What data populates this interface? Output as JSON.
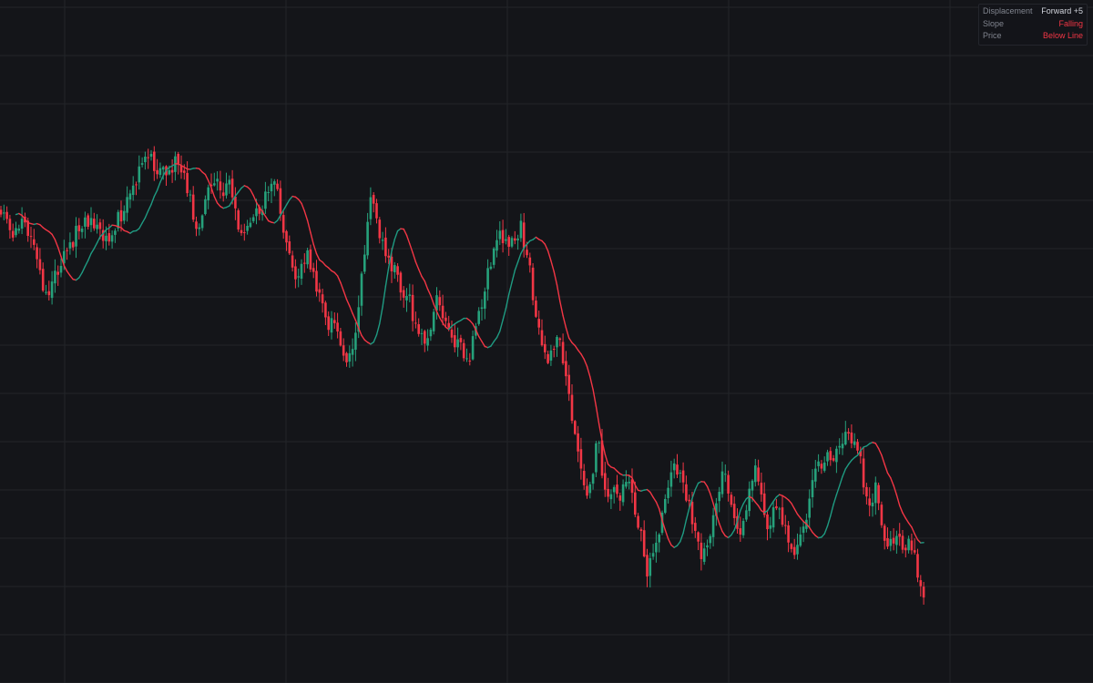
{
  "legend": {
    "displacement_label": "Displacement",
    "displacement_value": "Forward +5",
    "slope_label": "Slope",
    "slope_value": "Falling",
    "price_label": "Price",
    "price_value": "Below Line"
  },
  "colors": {
    "background": "#141519",
    "grid": "#232529",
    "up": "#26a17b",
    "down": "#f23645",
    "line_rising": "#1f9b82",
    "line_falling": "#f23645"
  },
  "chart_data": {
    "type": "candlestick",
    "grid": true,
    "legend_position": "top-right",
    "indicator": {
      "type": "displaced moving average",
      "displacement": 5
    },
    "series_waypoints": [
      [
        0,
        230
      ],
      [
        8,
        238
      ],
      [
        14,
        262
      ],
      [
        20,
        242
      ],
      [
        28,
        248
      ],
      [
        36,
        262
      ],
      [
        44,
        300
      ],
      [
        52,
        332
      ],
      [
        60,
        300
      ],
      [
        68,
        285
      ],
      [
        76,
        275
      ],
      [
        84,
        255
      ],
      [
        92,
        245
      ],
      [
        100,
        240
      ],
      [
        108,
        250
      ],
      [
        114,
        268
      ],
      [
        120,
        258
      ],
      [
        128,
        242
      ],
      [
        134,
        235
      ],
      [
        140,
        215
      ],
      [
        146,
        195
      ],
      [
        150,
        200
      ],
      [
        156,
        182
      ],
      [
        162,
        172
      ],
      [
        168,
        178
      ],
      [
        174,
        190
      ],
      [
        180,
        183
      ],
      [
        186,
        186
      ],
      [
        192,
        178
      ],
      [
        198,
        188
      ],
      [
        204,
        202
      ],
      [
        210,
        225
      ],
      [
        216,
        250
      ],
      [
        222,
        232
      ],
      [
        228,
        208
      ],
      [
        234,
        196
      ],
      [
        240,
        198
      ],
      [
        246,
        215
      ],
      [
        252,
        198
      ],
      [
        258,
        235
      ],
      [
        266,
        260
      ],
      [
        272,
        242
      ],
      [
        280,
        232
      ],
      [
        288,
        225
      ],
      [
        296,
        200
      ],
      [
        302,
        205
      ],
      [
        308,
        230
      ],
      [
        314,
        266
      ],
      [
        320,
        290
      ],
      [
        326,
        310
      ],
      [
        332,
        295
      ],
      [
        338,
        278
      ],
      [
        344,
        305
      ],
      [
        350,
        320
      ],
      [
        356,
        344
      ],
      [
        362,
        356
      ],
      [
        368,
        363
      ],
      [
        374,
        378
      ],
      [
        380,
        392
      ],
      [
        386,
        386
      ],
      [
        392,
        358
      ],
      [
        398,
        295
      ],
      [
        404,
        245
      ],
      [
        408,
        203
      ],
      [
        412,
        235
      ],
      [
        418,
        262
      ],
      [
        424,
        275
      ],
      [
        430,
        292
      ],
      [
        436,
        305
      ],
      [
        442,
        330
      ],
      [
        448,
        320
      ],
      [
        454,
        355
      ],
      [
        460,
        368
      ],
      [
        466,
        378
      ],
      [
        472,
        362
      ],
      [
        478,
        330
      ],
      [
        484,
        335
      ],
      [
        490,
        352
      ],
      [
        496,
        376
      ],
      [
        502,
        370
      ],
      [
        508,
        388
      ],
      [
        514,
        395
      ],
      [
        520,
        372
      ],
      [
        526,
        342
      ],
      [
        532,
        322
      ],
      [
        538,
        290
      ],
      [
        544,
        265
      ],
      [
        550,
        258
      ],
      [
        556,
        262
      ],
      [
        562,
        262
      ],
      [
        568,
        262
      ],
      [
        572,
        245
      ],
      [
        578,
        280
      ],
      [
        584,
        312
      ],
      [
        590,
        360
      ],
      [
        596,
        376
      ],
      [
        602,
        392
      ],
      [
        608,
        385
      ],
      [
        614,
        372
      ],
      [
        620,
        400
      ],
      [
        626,
        445
      ],
      [
        632,
        488
      ],
      [
        638,
        520
      ],
      [
        644,
        540
      ],
      [
        650,
        520
      ],
      [
        656,
        478
      ],
      [
        662,
        528
      ],
      [
        668,
        545
      ],
      [
        674,
        528
      ],
      [
        680,
        545
      ],
      [
        686,
        528
      ],
      [
        692,
        540
      ],
      [
        698,
        565
      ],
      [
        704,
        588
      ],
      [
        710,
        628
      ],
      [
        716,
        618
      ],
      [
        722,
        586
      ],
      [
        728,
        562
      ],
      [
        734,
        535
      ],
      [
        740,
        515
      ],
      [
        746,
        525
      ],
      [
        752,
        545
      ],
      [
        758,
        562
      ],
      [
        764,
        578
      ],
      [
        770,
        615
      ],
      [
        776,
        608
      ],
      [
        782,
        580
      ],
      [
        788,
        548
      ],
      [
        794,
        522
      ],
      [
        800,
        540
      ],
      [
        806,
        576
      ],
      [
        812,
        598
      ],
      [
        818,
        570
      ],
      [
        824,
        530
      ],
      [
        830,
        508
      ],
      [
        836,
        548
      ],
      [
        842,
        575
      ],
      [
        848,
        566
      ],
      [
        854,
        552
      ],
      [
        860,
        580
      ],
      [
        866,
        590
      ],
      [
        872,
        612
      ],
      [
        878,
        598
      ],
      [
        884,
        568
      ],
      [
        890,
        542
      ],
      [
        896,
        520
      ],
      [
        902,
        510
      ],
      [
        908,
        500
      ],
      [
        914,
        510
      ],
      [
        920,
        490
      ],
      [
        926,
        476
      ],
      [
        932,
        478
      ],
      [
        938,
        486
      ],
      [
        944,
        500
      ],
      [
        950,
        540
      ],
      [
        956,
        550
      ],
      [
        962,
        535
      ],
      [
        968,
        578
      ],
      [
        974,
        592
      ],
      [
        980,
        596
      ],
      [
        986,
        590
      ],
      [
        992,
        612
      ],
      [
        998,
        596
      ],
      [
        1004,
        605
      ],
      [
        1010,
        640
      ],
      [
        1015,
        660
      ]
    ]
  }
}
